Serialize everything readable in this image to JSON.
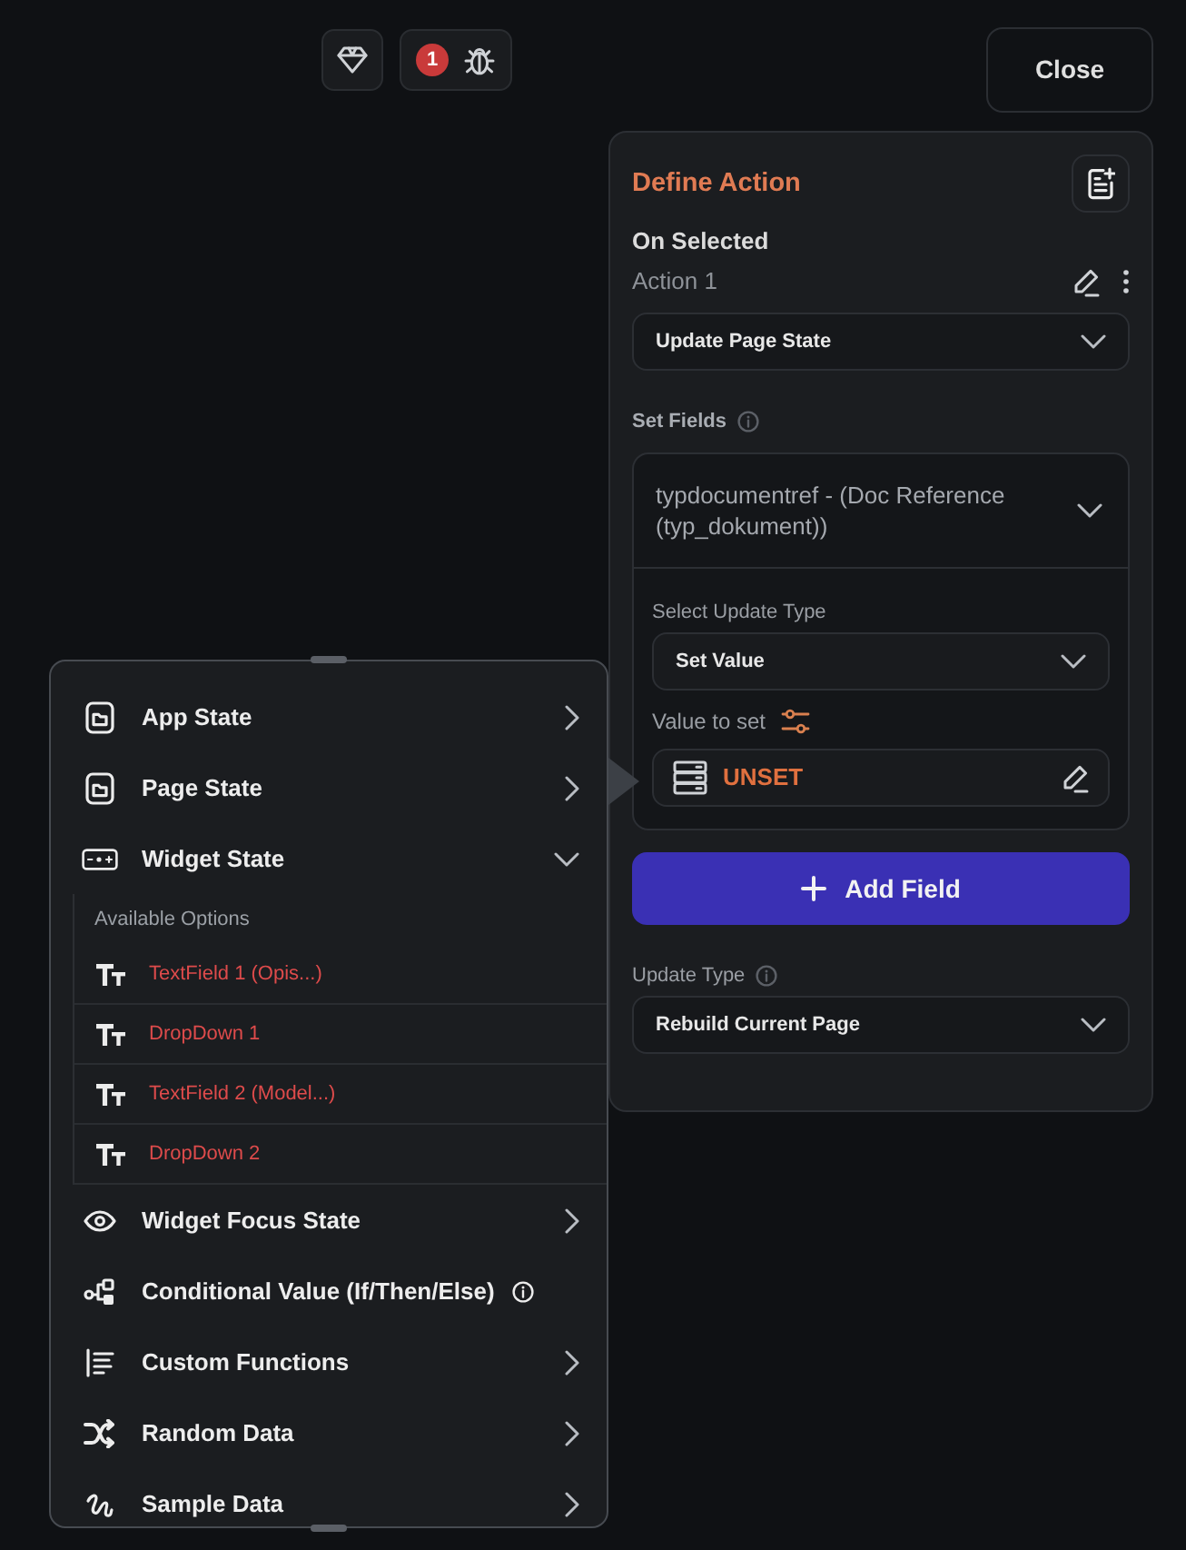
{
  "toolbar": {
    "error_count": "1",
    "close_label": "Close"
  },
  "action_panel": {
    "title": "Define Action",
    "trigger": "On Selected",
    "action_name": "Action 1",
    "action_type": "Update Page State",
    "set_fields_label": "Set Fields",
    "fields": [
      {
        "name": "typdocumentref - (Doc Reference (typ_dokument))",
        "expanded": true,
        "select_type_label": "Select Update Type",
        "update_type": "Set Value",
        "value_label": "Value to set",
        "value": "UNSET"
      }
    ],
    "add_field_label": "Add Field",
    "update_type_label": "Update Type",
    "update_type": "Rebuild Current Page"
  },
  "value_menu": {
    "items": [
      {
        "label": "App State",
        "kind": "submenu",
        "expanded": false
      },
      {
        "label": "Page State",
        "kind": "submenu",
        "expanded": false
      },
      {
        "label": "Widget State",
        "kind": "submenu",
        "expanded": true,
        "options_label": "Available Options",
        "options": [
          "TextField 1 (Opis...)",
          "DropDown 1",
          "TextField 2 (Model...)",
          "DropDown 2"
        ]
      },
      {
        "label": "Widget Focus State",
        "kind": "submenu",
        "expanded": false
      },
      {
        "label": "Conditional Value (If/Then/Else)",
        "kind": "info"
      },
      {
        "label": "Custom Functions",
        "kind": "submenu",
        "expanded": false
      },
      {
        "label": "Random Data",
        "kind": "submenu",
        "expanded": false
      },
      {
        "label": "Sample Data",
        "kind": "submenu",
        "expanded": false
      }
    ]
  }
}
